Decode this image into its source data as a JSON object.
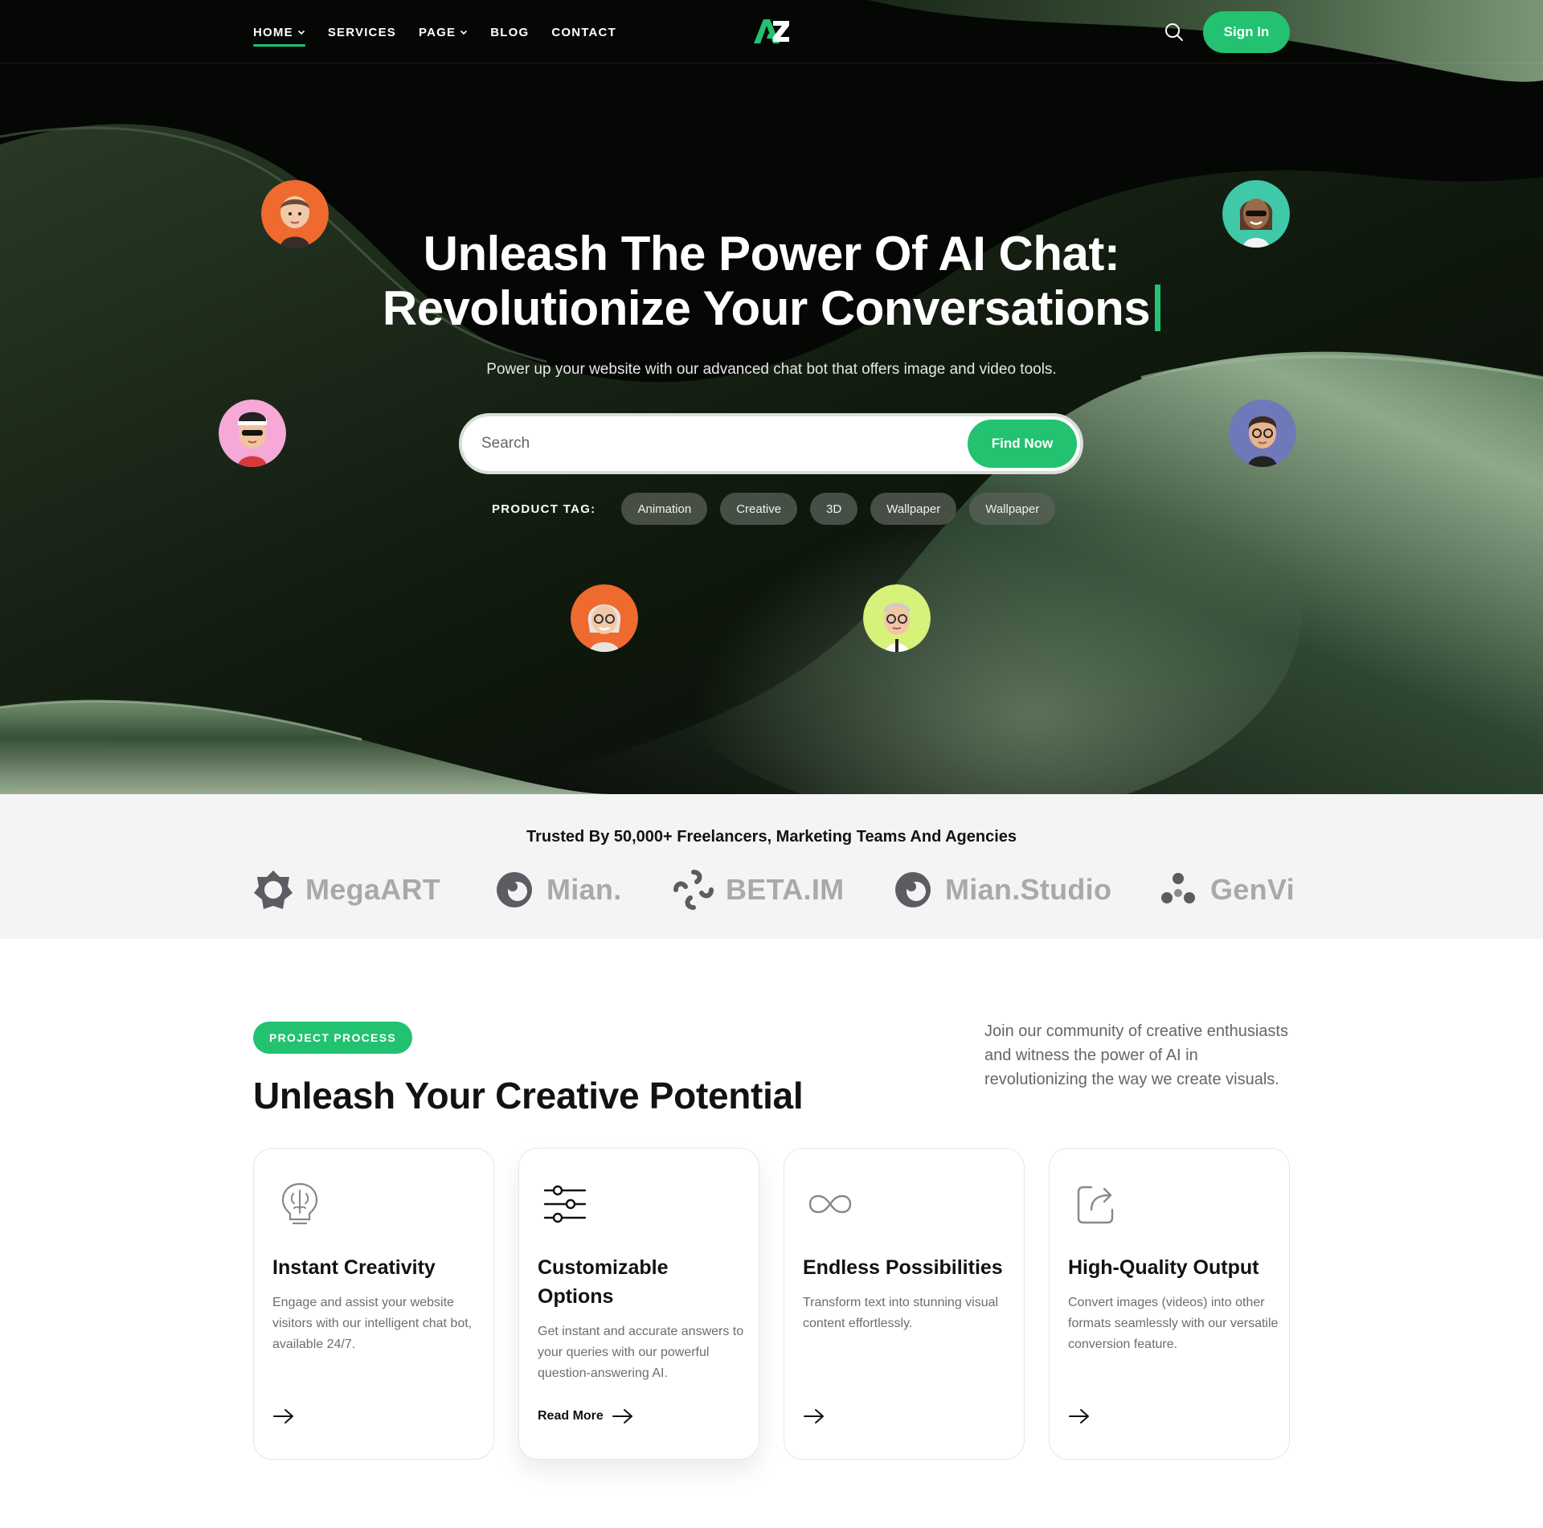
{
  "nav": {
    "links": [
      {
        "label": "HOME",
        "dropdown": true,
        "active": true
      },
      {
        "label": "SERVICES",
        "dropdown": false
      },
      {
        "label": "PAGE",
        "dropdown": true
      },
      {
        "label": "BLOG",
        "dropdown": false
      },
      {
        "label": "CONTACT",
        "dropdown": false
      }
    ],
    "logo_text": "AZ",
    "search_icon": "search-icon",
    "signin_label": "Sign In"
  },
  "hero": {
    "title_line1": "Unleash The Power Of AI Chat:",
    "title_line2": "Revolutionize Your Conversations",
    "subtitle": "Power up your website with our advanced chat bot that offers image and video tools.",
    "search_placeholder": "Search",
    "find_button": "Find Now",
    "tag_label": "PRODUCT TAG:",
    "tags": [
      "Animation",
      "Creative",
      "3D",
      "Wallpaper",
      "Wallpaper"
    ]
  },
  "trusted": {
    "title": "Trusted By 50,000+ Freelancers, Marketing Teams And Agencies",
    "brands": [
      "MegaART",
      "Mian.",
      "BETA.IM",
      "Mian.Studio",
      "GenVi"
    ]
  },
  "process": {
    "pill": "PROJECT PROCESS",
    "title": "Unleash Your Creative Potential",
    "description": "Join our community of creative enthusiasts and witness the power of AI in revolutionizing the way we create visuals.",
    "cards": [
      {
        "title": "Instant Creativity",
        "text": "Engage and assist your website visitors with our intelligent chat bot, available 24/7.",
        "icon": "brain-bulb-icon"
      },
      {
        "title": "Customizable Options",
        "text": "Get instant and accurate answers to your queries with our powerful question-answering AI.",
        "link": "Read More",
        "icon": "sliders-icon"
      },
      {
        "title": "Endless Possibilities",
        "text": "Transform text into stunning visual content effortlessly.",
        "icon": "infinity-icon"
      },
      {
        "title": "High-Quality Output",
        "text": "Convert images (videos) into other formats seamlessly with our versatile conversion feature.",
        "icon": "share-icon"
      }
    ]
  },
  "colors": {
    "accent": "#22c271",
    "hero_bg": "#060806",
    "wave": "#7f9b7a"
  }
}
